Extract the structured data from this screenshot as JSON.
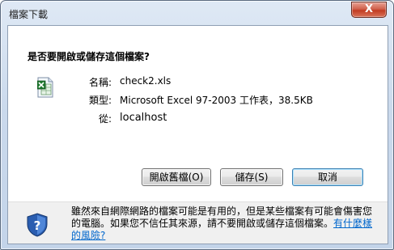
{
  "window": {
    "title": "檔案下載",
    "close_label": "X"
  },
  "dialog": {
    "question": "是否要開啟或儲存這個檔案?",
    "file": {
      "name_label": "名稱:",
      "name_value": "check2.xls",
      "type_label": "類型:",
      "type_value": "Microsoft Excel 97-2003 工作表，38.5KB",
      "from_label": "從:",
      "from_value": "localhost"
    },
    "buttons": {
      "open": "開啟舊檔(O)",
      "save": "儲存(S)",
      "cancel": "取消"
    },
    "warning": {
      "text": "雖然來自網際網路的檔案可能是有用的，但是某些檔案有可能會傷害您的電腦。如果您不信任其來源，請不要開啟或儲存這個檔案。",
      "link": "有什麼樣的風險?"
    }
  },
  "colors": {
    "close_button": "#c23c22",
    "link": "#0066cc",
    "shield": "#2a5db0"
  },
  "icons": {
    "file": "excel-file-icon",
    "warning": "shield-question-icon"
  }
}
